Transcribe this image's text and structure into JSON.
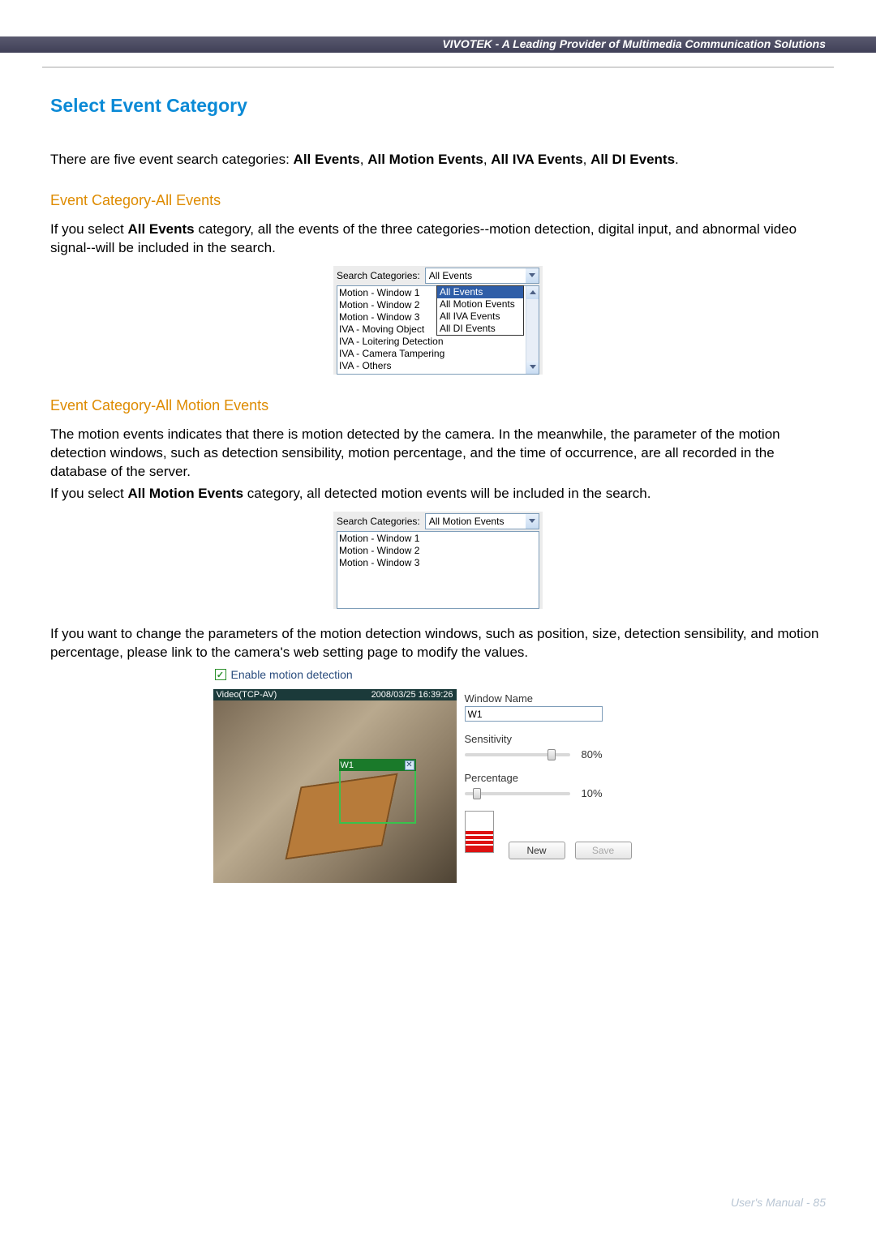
{
  "header": {
    "text": "VIVOTEK - A Leading Provider of Multimedia Communication Solutions"
  },
  "title": "Select Event Category",
  "intro": {
    "pre": "There are five event search categories: ",
    "c1": "All Events",
    "c2": "All Motion Events",
    "c3": "All IVA Events",
    "c4": "All DI Events",
    "sep": ", ",
    "end": "."
  },
  "sec1": {
    "heading": "Event Category-All Events",
    "p_pre": "If you select ",
    "p_bold": "All Events",
    "p_post": " category, all the events of the three categories--motion detection, digital input, and abnormal video signal--will be included in the search.",
    "label": "Search Categories:",
    "selected": "All Events",
    "dropdown": {
      "hi": "All Events",
      "i1": "All Motion Events",
      "i2": "All IVA Events",
      "i3": "All DI Events"
    },
    "list": {
      "i0": "Motion - Window 1",
      "i1": "Motion - Window 2",
      "i2": "Motion - Window 3",
      "i3": "IVA - Moving Object",
      "i4": "IVA - Loitering Detection",
      "i5": "IVA - Camera Tampering",
      "i6": "IVA - Others"
    }
  },
  "sec2": {
    "heading": "Event Category-All Motion Events",
    "p1": "The motion events indicates that there is motion detected by the camera. In the meanwhile, the parameter of the motion detection windows, such as detection sensibility, motion percentage, and the time of occurrence, are all recorded in the database of the server.",
    "p2_pre": "If you select ",
    "p2_bold": "All Motion Events",
    "p2_post": " category, all detected motion events will be included in the search.",
    "label": "Search Categories:",
    "selected": "All Motion Events",
    "list": {
      "i0": "Motion - Window 1",
      "i1": "Motion - Window 2",
      "i2": "Motion - Window 3"
    },
    "p3": "If you want to change the parameters of the motion detection windows, such as position, size, detection sensibility, and motion percentage, please link to the camera's web setting page to modify the values."
  },
  "md": {
    "enable": "Enable motion detection",
    "vidmode": "Video(TCP-AV)",
    "timestamp": "2008/03/25 16:39:26",
    "mw_label": "W1",
    "wname_lbl": "Window Name",
    "wname_val": "W1",
    "sens_lbl": "Sensitivity",
    "sens_val": "80%",
    "perc_lbl": "Percentage",
    "perc_val": "10%",
    "btn_new": "New",
    "btn_save": "Save"
  },
  "footer": "User's Manual - 85"
}
